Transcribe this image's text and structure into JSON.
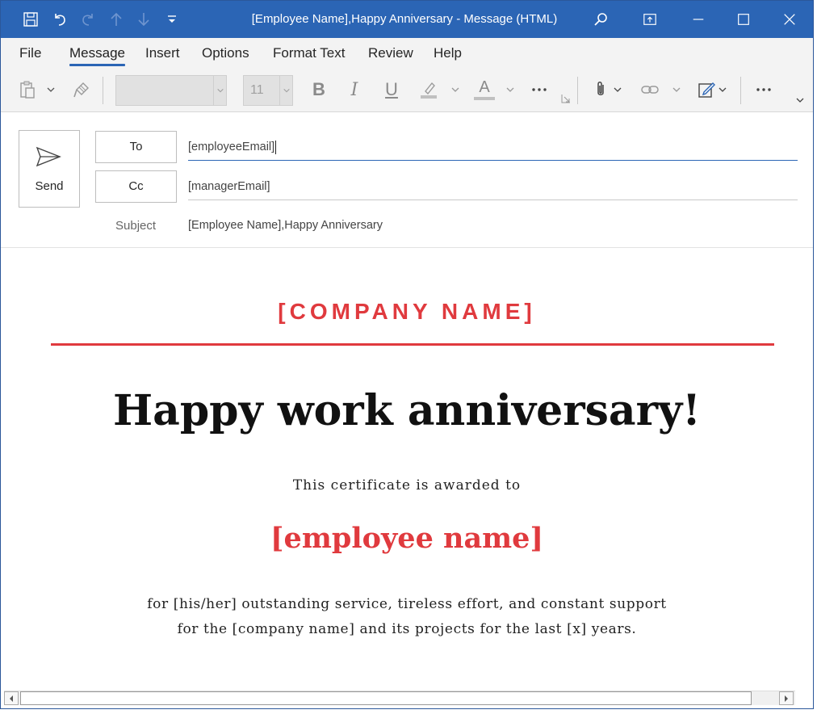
{
  "titlebar": {
    "title": "[Employee Name],Happy Anniversary  -  Message (HTML)",
    "icons": [
      "save-icon",
      "undo-icon",
      "redo-icon",
      "up-icon",
      "down-icon",
      "customize-icon",
      "search-icon",
      "restore-ribbon-icon",
      "minimize-icon",
      "maximize-icon",
      "close-icon"
    ]
  },
  "menu": {
    "tabs": [
      "File",
      "Message",
      "Insert",
      "Options",
      "Format Text",
      "Review",
      "Help"
    ],
    "active": "Message"
  },
  "ribbon": {
    "font_name": "",
    "font_size": "11",
    "bold": "B",
    "italic": "I",
    "underline": "U",
    "font_color": "A"
  },
  "header": {
    "send_label": "Send",
    "to_label": "To",
    "cc_label": "Cc",
    "to_value": "[employeeEmail]",
    "cc_value": "[managerEmail]",
    "subject_label": "Subject",
    "subject_value": "[Employee Name],Happy Anniversary"
  },
  "body": {
    "company": "[COMPANY NAME]",
    "headline": "Happy work anniversary!",
    "awarded": "This certificate is awarded to",
    "employee_name": "[employee name]",
    "para_line1": "for [his/her] outstanding service, tireless effort, and constant support",
    "para_line2": "for the [company name] and its projects for the last [x] years."
  },
  "colors": {
    "titlebar": "#2b65b5",
    "accent_red": "#e03a3e"
  }
}
